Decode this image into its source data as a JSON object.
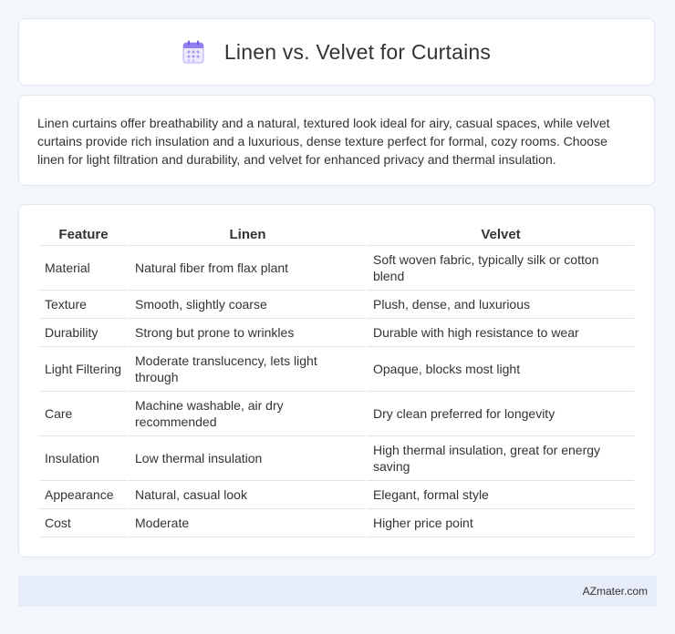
{
  "header": {
    "title": "Linen vs. Velvet for Curtains",
    "icon": "calendar-icon"
  },
  "intro": {
    "text": "Linen curtains offer breathability and a natural, textured look ideal for airy, casual spaces, while velvet curtains provide rich insulation and a luxurious, dense texture perfect for formal, cozy rooms. Choose linen for light filtration and durability, and velvet for enhanced privacy and thermal insulation."
  },
  "table": {
    "headers": [
      "Feature",
      "Linen",
      "Velvet"
    ],
    "rows": [
      [
        "Material",
        "Natural fiber from flax plant",
        "Soft woven fabric, typically silk or cotton blend"
      ],
      [
        "Texture",
        "Smooth, slightly coarse",
        "Plush, dense, and luxurious"
      ],
      [
        "Durability",
        "Strong but prone to wrinkles",
        "Durable with high resistance to wear"
      ],
      [
        "Light Filtering",
        "Moderate translucency, lets light through",
        "Opaque, blocks most light"
      ],
      [
        "Care",
        "Machine washable, air dry recommended",
        "Dry clean preferred for longevity"
      ],
      [
        "Insulation",
        "Low thermal insulation",
        "High thermal insulation, great for energy saving"
      ],
      [
        "Appearance",
        "Natural, casual look",
        "Elegant, formal style"
      ],
      [
        "Cost",
        "Moderate",
        "Higher price point"
      ]
    ]
  },
  "footer": {
    "brand": "AZmater.com"
  },
  "colors": {
    "background": "#f3f6fa",
    "card": "#ffffff",
    "footer": "#e6edf8",
    "icon_accent": "#8f7ff0"
  }
}
